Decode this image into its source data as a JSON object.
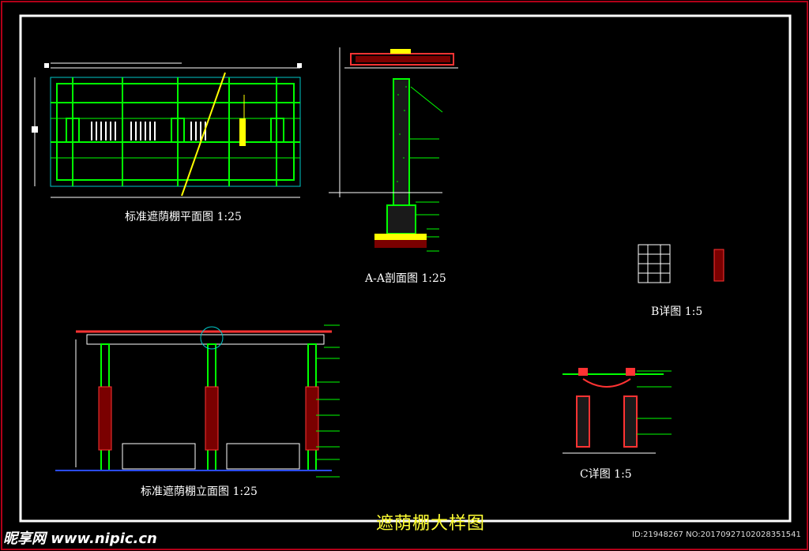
{
  "titles": {
    "plan": "标准遮荫棚平面图 1:25",
    "section": "A-A剖面图 1:25",
    "detail_b": "B详图 1:5",
    "elevation": "标准遮荫棚立面图 1:25",
    "detail_c": "C详图 1:5",
    "main": "遮荫棚大样图"
  },
  "watermark": {
    "left": "昵享网 www.nipic.cn",
    "right": "ID:21948267 NO:20170927102028351541"
  },
  "colors": {
    "background": "#000000",
    "frame": "#ffffff",
    "accent_red": "#c0001a",
    "line_green": "#00ff00",
    "line_cyan": "#00c8c8",
    "line_yellow": "#ffff00"
  }
}
